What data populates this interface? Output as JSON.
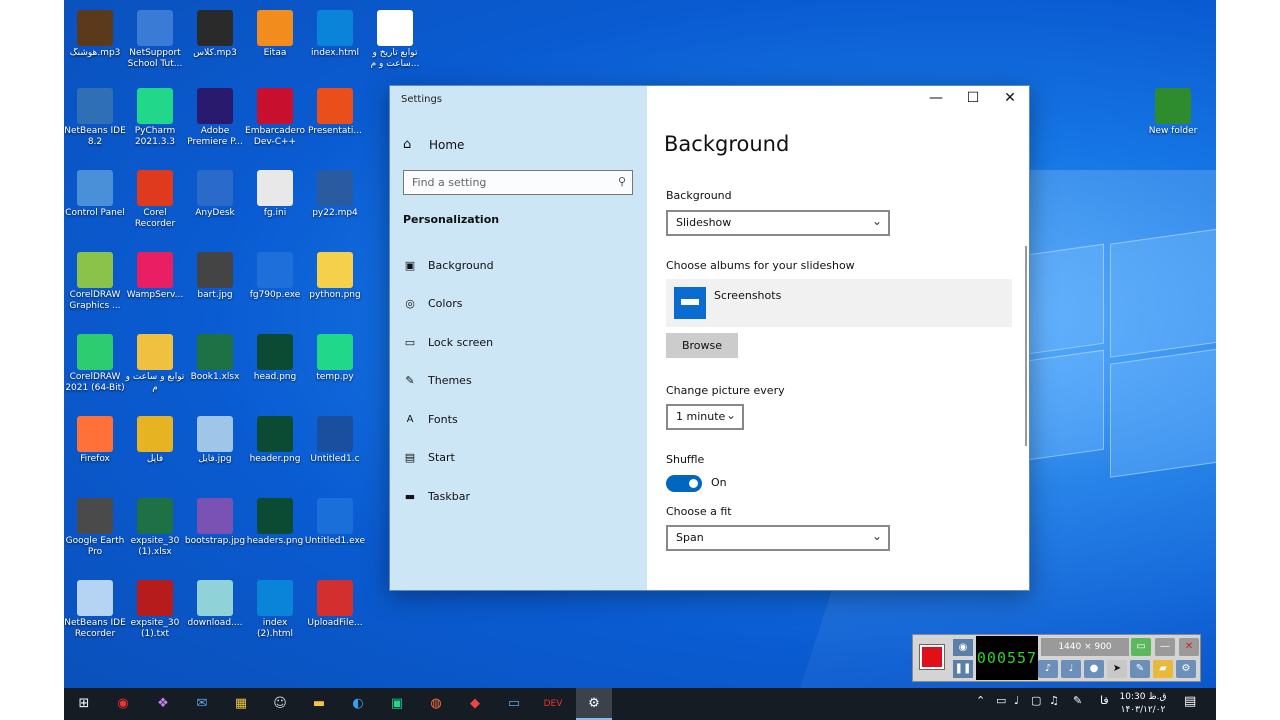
{
  "desktop": {
    "icons": [
      {
        "label": "هوشنگ.mp3",
        "color": "#5a3a1a"
      },
      {
        "label": "NetSupport School Tut...",
        "color": "#3a7bd5"
      },
      {
        "label": "کلاس.mp3",
        "color": "#2a2a2a"
      },
      {
        "label": "Eitaa",
        "color": "#f28c1c"
      },
      {
        "label": "index.html",
        "color": "#0a84d8"
      },
      {
        "label": "توابع تاریخ و ساعت و م...",
        "color": "#ffffff"
      },
      {
        "label": "NetBeans IDE 8.2",
        "color": "#2f6fb5"
      },
      {
        "label": "PyCharm 2021.3.3",
        "color": "#21d789"
      },
      {
        "label": "Adobe Premiere P...",
        "color": "#2a1a6e"
      },
      {
        "label": "Embarcadero Dev-C++",
        "color": "#c8102e"
      },
      {
        "label": "Presentati...",
        "color": "#e94e1b"
      },
      {
        "label": "Control Panel",
        "color": "#4a90d9"
      },
      {
        "label": "Corel Recorder",
        "color": "#e03a1e"
      },
      {
        "label": "AnyDesk",
        "color": "#2a6bc9"
      },
      {
        "label": "fg.ini",
        "color": "#e8e8e8"
      },
      {
        "label": "py22.mp4",
        "color": "#2a5aa0"
      },
      {
        "label": "CorelDRAW Graphics ...",
        "color": "#8bc34a"
      },
      {
        "label": "WampServ...",
        "color": "#e91e63"
      },
      {
        "label": "bart.jpg",
        "color": "#444444"
      },
      {
        "label": "fg790p.exe",
        "color": "#1e6fd9"
      },
      {
        "label": "python.png",
        "color": "#f5d04a"
      },
      {
        "label": "CorelDRAW 2021 (64-Bit)",
        "color": "#2ecc71"
      },
      {
        "label": "توابع و ساعت و م",
        "color": "#f0c040"
      },
      {
        "label": "Book1.xlsx",
        "color": "#1e7145"
      },
      {
        "label": "head.png",
        "color": "#0c4b33"
      },
      {
        "label": "temp.py",
        "color": "#21d789"
      },
      {
        "label": "Firefox",
        "color": "#ff7139"
      },
      {
        "label": "فایل",
        "color": "#e6b422"
      },
      {
        "label": "فایل.jpg",
        "color": "#9fc5e8"
      },
      {
        "label": "header.png",
        "color": "#0c4b33"
      },
      {
        "label": "Untitled1.c",
        "color": "#1a4fa0"
      },
      {
        "label": "Google Earth Pro",
        "color": "#4a4a4a"
      },
      {
        "label": "expsite_30 (1).xlsx",
        "color": "#1e7145"
      },
      {
        "label": "bootstrap.jpg",
        "color": "#7952b3"
      },
      {
        "label": "headers.png",
        "color": "#0c4b33"
      },
      {
        "label": "Untitled1.exe",
        "color": "#1a6fd9"
      },
      {
        "label": "NetBeans IDE Recorder",
        "color": "#b5d4f4"
      },
      {
        "label": "expsite_30 (1).txt",
        "color": "#b71c1c"
      },
      {
        "label": "download....",
        "color": "#8fd3d8"
      },
      {
        "label": "index (2).html",
        "color": "#0a84d8"
      },
      {
        "label": "UploadFile...",
        "color": "#d32f2f"
      },
      {
        "label": "New folder",
        "color": "#2e8b2e"
      }
    ]
  },
  "settings": {
    "window_title": "Settings",
    "controls": {
      "minimize": "—",
      "maximize": "☐",
      "close": "✕"
    },
    "nav": {
      "home": "Home",
      "search_placeholder": "Find a setting",
      "section": "Personalization",
      "items": [
        {
          "label": "Background",
          "icon": "image-icon"
        },
        {
          "label": "Colors",
          "icon": "palette-icon"
        },
        {
          "label": "Lock screen",
          "icon": "lock-screen-icon"
        },
        {
          "label": "Themes",
          "icon": "themes-icon"
        },
        {
          "label": "Fonts",
          "icon": "fonts-icon"
        },
        {
          "label": "Start",
          "icon": "start-icon"
        },
        {
          "label": "Taskbar",
          "icon": "taskbar-icon"
        }
      ]
    },
    "content": {
      "title": "Background",
      "background_label": "Background",
      "background_value": "Slideshow",
      "albums_label": "Choose albums for your slideshow",
      "album_name": "Screenshots",
      "browse_label": "Browse",
      "change_label": "Change picture every",
      "change_value": "1 minute",
      "shuffle_label": "Shuffle",
      "shuffle_state": "On",
      "fit_label": "Choose a fit",
      "fit_value": "Span"
    }
  },
  "recorder": {
    "timer": "000557",
    "resolution": "1440 × 900"
  },
  "taskbar": {
    "tray_lang": "فا",
    "clock_time": "10:30 ق.ظ",
    "clock_date": "۱۴۰۳/۱۲/۰۲"
  },
  "colors": {
    "accent": "#0067c0",
    "desktop": "#0a5bd1",
    "taskbar": "#161c24"
  }
}
